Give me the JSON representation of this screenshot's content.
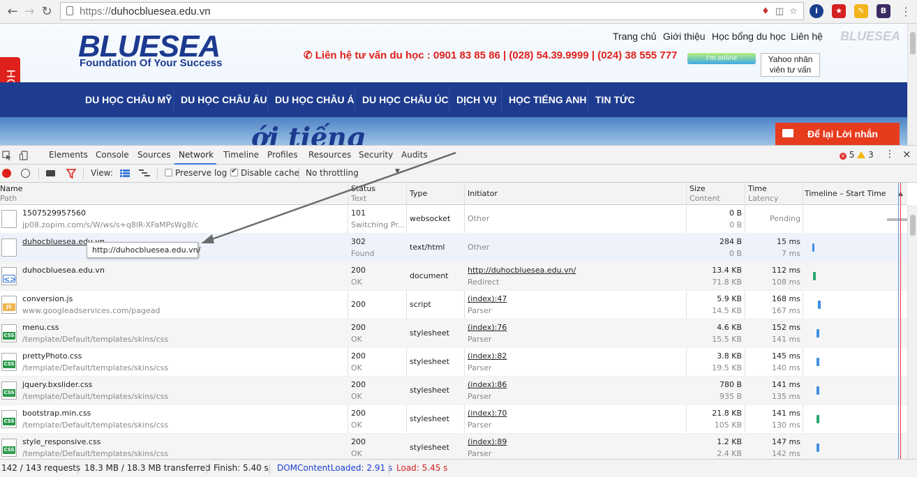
{
  "browser": {
    "url_scheme": "https://",
    "url_host": "duhocbluesea.edu.vn"
  },
  "site": {
    "logo_main": "BLUESEA",
    "logo_tagline": "Foundation Of Your Success",
    "logo_faint": "BLUESEA",
    "topnav": [
      "Trang chủ",
      "Giới thiệu",
      "Học bổng du học",
      "Liên hệ"
    ],
    "contact_line": "Liên hệ tư vấn du học : 0901 83 85 86 | (028) 54.39.9999 | (024) 38 555 777",
    "online_label": "I'm online",
    "yahoo_alt": "Yahoo nhân viên tư vấn",
    "hotline": "HOTLINE",
    "mainnav": [
      "DU HỌC CHÂU MỸ",
      "DU HỌC CHÂU ÂU",
      "DU HỌC CHÂU Á",
      "DU HỌC CHÂU ÚC",
      "DỊCH VỤ",
      "HỌC TIẾNG ANH",
      "TIN TỨC"
    ],
    "banner_text": "ới tiếng",
    "leave_message": "Để lại Lời nhắn"
  },
  "devtools": {
    "tabs": [
      "Elements",
      "Console",
      "Sources",
      "Network",
      "Timeline",
      "Profiles",
      "Resources",
      "Security",
      "Audits"
    ],
    "active_tab": "Network",
    "errors": "5",
    "warnings": "3",
    "toolbar": {
      "view_label": "View:",
      "preserve_log": "Preserve log",
      "disable_cache": "Disable cache",
      "throttling": "No throttling"
    },
    "columns": {
      "name": "Name",
      "name_sub": "Path",
      "status": "Status",
      "status_sub": "Text",
      "type": "Type",
      "initiator": "Initiator",
      "size": "Size",
      "size_sub": "Content",
      "time": "Time",
      "time_sub": "Latency",
      "timeline": "Timeline – Start Time"
    },
    "rows": [
      {
        "name": "1507529957560",
        "path": "jp08.zopim.com/s/W/ws/s+q8lR-XFaMPsWg8/c",
        "status": "101",
        "status_text": "Switching Pr...",
        "type": "websocket",
        "initiator": "Other",
        "initiator_sub": "",
        "size": "0 B",
        "content": "0 B",
        "time": "",
        "latency": "Pending"
      },
      {
        "name": "duhocbluesea.edu.vn",
        "path": "",
        "status": "302",
        "status_text": "Found",
        "type": "text/html",
        "initiator": "Other",
        "initiator_sub": "",
        "size": "284 B",
        "content": "0 B",
        "time": "15 ms",
        "latency": "7 ms"
      },
      {
        "name": "duhocbluesea.edu.vn",
        "path": "",
        "status": "200",
        "status_text": "OK",
        "type": "document",
        "initiator": "http://duhocbluesea.edu.vn/",
        "initiator_sub": "Redirect",
        "size": "13.4 KB",
        "content": "71.8 KB",
        "time": "112 ms",
        "latency": "108 ms"
      },
      {
        "name": "conversion.js",
        "path": "www.googleadservices.com/pagead",
        "status": "200",
        "status_text": "",
        "type": "script",
        "initiator": "(index):47",
        "initiator_sub": "Parser",
        "size": "5.9 KB",
        "content": "14.5 KB",
        "time": "168 ms",
        "latency": "167 ms"
      },
      {
        "name": "menu.css",
        "path": "/template/Default/templates/skins/css",
        "status": "200",
        "status_text": "OK",
        "type": "stylesheet",
        "initiator": "(index):76",
        "initiator_sub": "Parser",
        "size": "4.6 KB",
        "content": "15.5 KB",
        "time": "152 ms",
        "latency": "141 ms"
      },
      {
        "name": "prettyPhoto.css",
        "path": "/template/Default/templates/skins/css",
        "status": "200",
        "status_text": "OK",
        "type": "stylesheet",
        "initiator": "(index):82",
        "initiator_sub": "Parser",
        "size": "3.8 KB",
        "content": "19.5 KB",
        "time": "145 ms",
        "latency": "140 ms"
      },
      {
        "name": "jquery.bxslider.css",
        "path": "/template/Default/templates/skins/css",
        "status": "200",
        "status_text": "OK",
        "type": "stylesheet",
        "initiator": "(index):86",
        "initiator_sub": "Parser",
        "size": "780 B",
        "content": "935 B",
        "time": "141 ms",
        "latency": "135 ms"
      },
      {
        "name": "bootstrap.min.css",
        "path": "/template/Default/templates/skins/css",
        "status": "200",
        "status_text": "OK",
        "type": "stylesheet",
        "initiator": "(index):70",
        "initiator_sub": "Parser",
        "size": "21.8 KB",
        "content": "105 KB",
        "time": "141 ms",
        "latency": "130 ms"
      },
      {
        "name": "style_responsive.css",
        "path": "/template/Default/templates/skins/css",
        "status": "200",
        "status_text": "OK",
        "type": "stylesheet",
        "initiator": "(index):89",
        "initiator_sub": "Parser",
        "size": "1.2 KB",
        "content": "2.4 KB",
        "time": "147 ms",
        "latency": "142 ms"
      }
    ],
    "tooltip": "http://duhocbluesea.edu.vn/",
    "status": {
      "requests": "142 / 143 requests",
      "transferred": "18.3 MB / 18.3 MB transferred",
      "finish": "Finish: 5.40 s",
      "dcl": "DOMContentLoaded: 2.91 s",
      "load": "Load: 5.45 s"
    },
    "colors": {
      "dcl": "#1a3fd1",
      "load": "#d42020",
      "accent": "#3879d9"
    }
  }
}
